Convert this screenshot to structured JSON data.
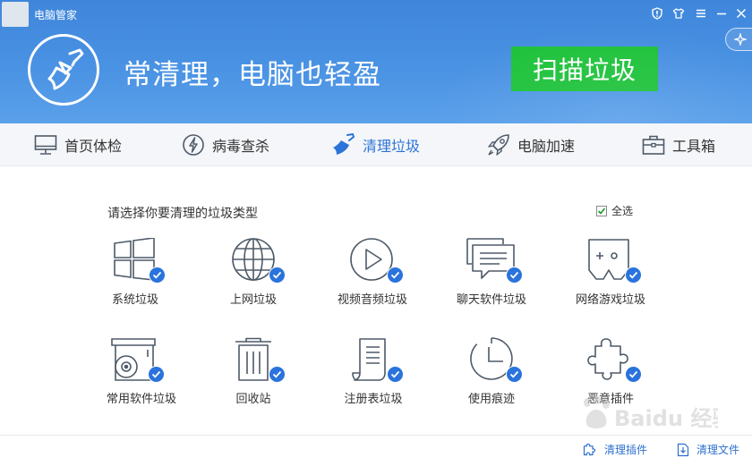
{
  "window": {
    "title": "电脑管家"
  },
  "header": {
    "slogan": "常清理，电脑也轻盈",
    "scan_button": "扫描垃圾"
  },
  "tabs": [
    {
      "label": "首页体检",
      "icon": "monitor-icon",
      "active": false
    },
    {
      "label": "病毒查杀",
      "icon": "bolt-icon",
      "active": false
    },
    {
      "label": "清理垃圾",
      "icon": "broom-icon",
      "active": true
    },
    {
      "label": "电脑加速",
      "icon": "rocket-icon",
      "active": false
    },
    {
      "label": "工具箱",
      "icon": "toolbox-icon",
      "active": false
    }
  ],
  "content": {
    "section_title": "请选择你要清理的垃圾类型",
    "select_all_label": "全选",
    "select_all_checked": true,
    "items": [
      {
        "label": "系统垃圾",
        "icon": "windows-icon",
        "checked": true
      },
      {
        "label": "上网垃圾",
        "icon": "globe-icon",
        "checked": true
      },
      {
        "label": "视频音频垃圾",
        "icon": "play-icon",
        "checked": true
      },
      {
        "label": "聊天软件垃圾",
        "icon": "chat-icon",
        "checked": true
      },
      {
        "label": "网络游戏垃圾",
        "icon": "gamepad-icon",
        "checked": true
      },
      {
        "label": "常用软件垃圾",
        "icon": "disc-drive-icon",
        "checked": true
      },
      {
        "label": "回收站",
        "icon": "trash-icon",
        "checked": true
      },
      {
        "label": "注册表垃圾",
        "icon": "registry-icon",
        "checked": true
      },
      {
        "label": "使用痕迹",
        "icon": "clock-icon",
        "checked": true
      },
      {
        "label": "恶意插件",
        "icon": "puzzle-icon",
        "checked": true
      }
    ]
  },
  "footer": {
    "clean_plugins": "清理插件",
    "clean_files": "清理文件"
  },
  "watermark": {
    "text": "Baidu 经验"
  },
  "colors": {
    "header_blue": "#4a8fe0",
    "scan_green": "#1ec23b",
    "accent_blue": "#2a73dc",
    "icon_stroke": "#4e5a68"
  }
}
